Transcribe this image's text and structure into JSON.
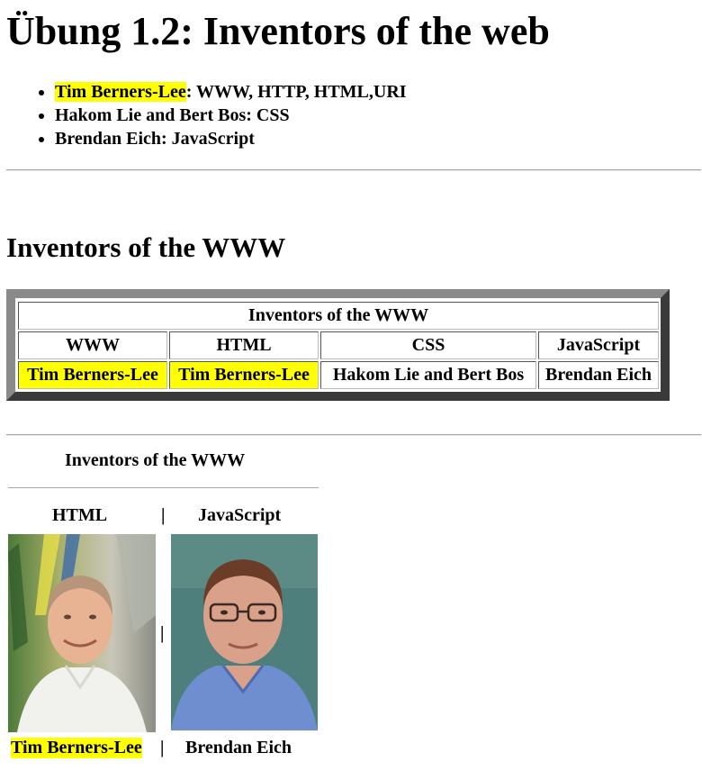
{
  "heading": "Übung 1.2: Inventors of the web",
  "list": [
    {
      "name": "Tim Berners-Lee",
      "rest": ": WWW, HTTP, HTML,URI",
      "highlight": true
    },
    {
      "name": "Hakom Lie and Bert Bos",
      "rest": ": CSS",
      "highlight": false
    },
    {
      "name": "Brendan Eich",
      "rest": ": JavaScript",
      "highlight": false
    }
  ],
  "section_heading": "Inventors of the WWW",
  "table": {
    "caption": "Inventors of the WWW",
    "headers": [
      "WWW",
      "HTML",
      "CSS",
      "JavaScript"
    ],
    "row": [
      "Tim Berners-Lee",
      "Tim Berners-Lee",
      "Hakom Lie and Bert Bos",
      "Brendan Eich"
    ]
  },
  "gallery": {
    "title": "Inventors of the WWW",
    "separator": "|",
    "left_heading": "HTML",
    "right_heading": "JavaScript",
    "left_caption": "Tim Berners-Lee",
    "right_caption": "Brendan Eich"
  },
  "colors": {
    "highlight": "#ffff00",
    "frame_light": "#8a8a8a",
    "frame_dark": "#3a3a3a"
  }
}
